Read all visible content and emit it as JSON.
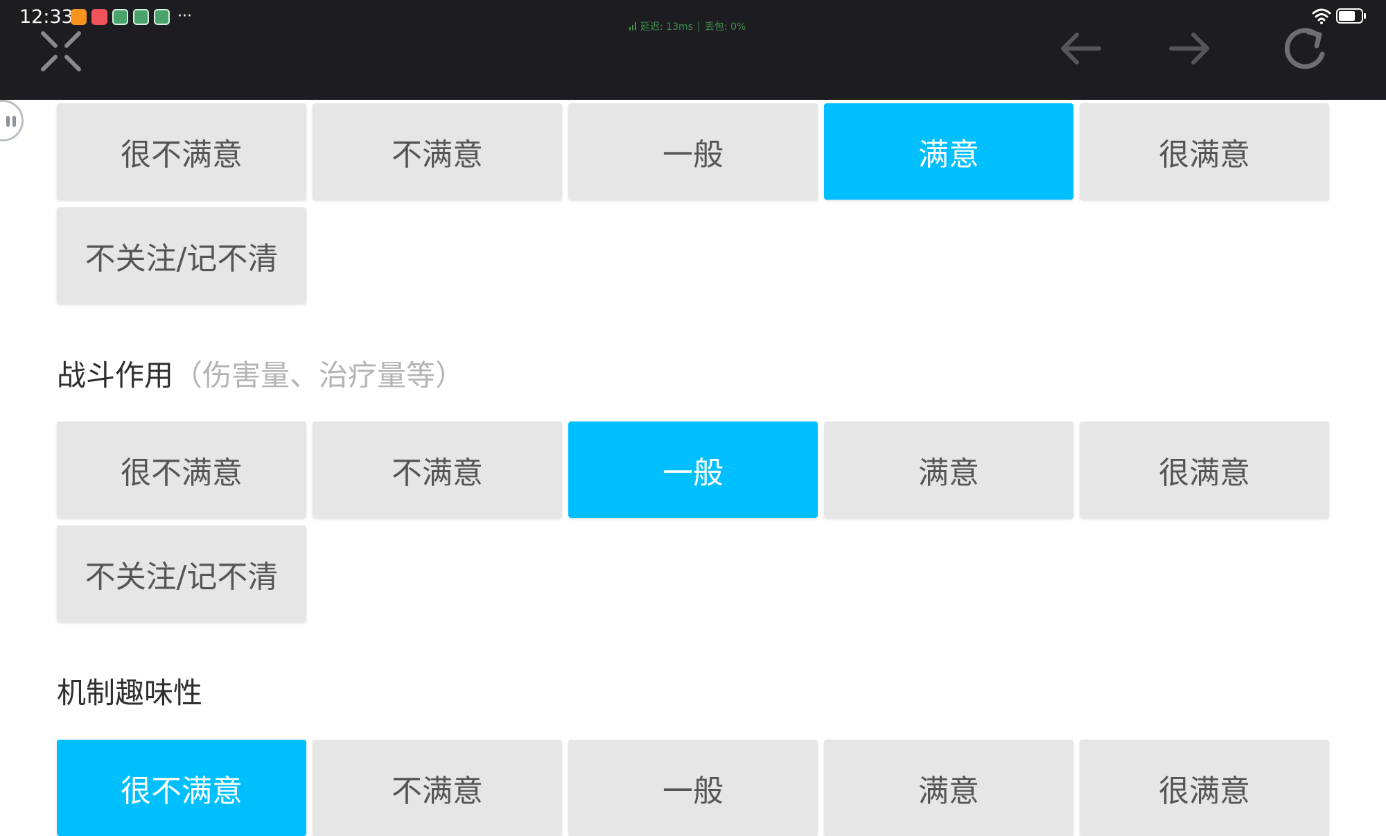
{
  "status_bar": {
    "time": "12:33",
    "notification_icons": [
      "app-notification-icon-orange",
      "app-notification-icon-red",
      "game-notification-icon",
      "game-notification-icon",
      "game-notification-icon"
    ],
    "more": "···",
    "network": {
      "latency_label": "延迟: 13ms",
      "loss_label": "丢包: 0%"
    }
  },
  "toolbar": {
    "close_icon": "close-icon",
    "back_icon": "arrow-left-icon",
    "forward_icon": "arrow-right-icon",
    "refresh_icon": "refresh-icon"
  },
  "colors": {
    "topbar": "#1d1d21",
    "selected": "#00bfff",
    "option_bg": "#e6e6e6",
    "option_text": "#555555",
    "hint_text": "#b4b4b4",
    "network_text": "#3f8f4a"
  },
  "questions": [
    {
      "title": "",
      "subtitle": "",
      "options": [
        "很不满意",
        "不满意",
        "一般",
        "满意",
        "很满意",
        "不关注/记不清"
      ],
      "selected": "满意"
    },
    {
      "title": "战斗作用",
      "subtitle": "（伤害量、治疗量等）",
      "options": [
        "很不满意",
        "不满意",
        "一般",
        "满意",
        "很满意",
        "不关注/记不清"
      ],
      "selected": "一般"
    },
    {
      "title": "机制趣味性",
      "subtitle": "",
      "options": [
        "很不满意",
        "不满意",
        "一般",
        "满意",
        "很满意"
      ],
      "selected": "很不满意"
    }
  ]
}
